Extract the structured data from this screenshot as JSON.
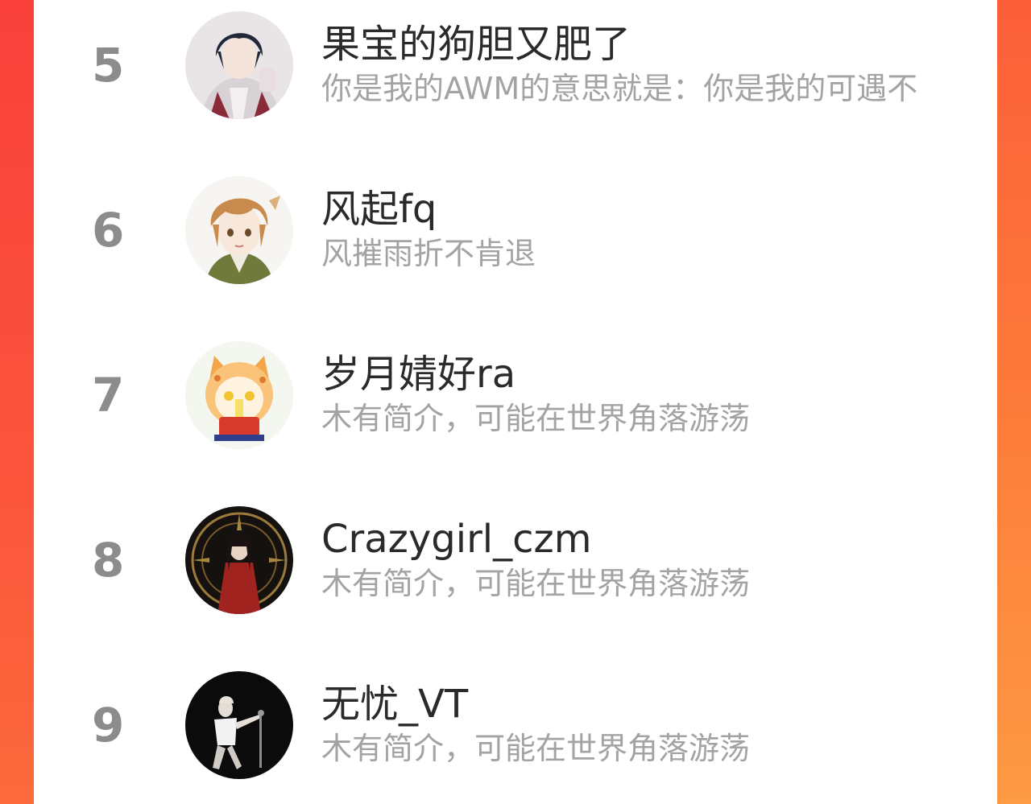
{
  "ranking": {
    "entries": [
      {
        "rank": "5",
        "name": "果宝的狗胆又肥了",
        "bio": "你是我的AWM的意思就是：你是我的可遇不"
      },
      {
        "rank": "6",
        "name": "风起fq",
        "bio": "风摧雨折不肯退"
      },
      {
        "rank": "7",
        "name": "岁月婧好ra",
        "bio": "木有简介，可能在世界角落游荡"
      },
      {
        "rank": "8",
        "name": "Crazygirl_czm",
        "bio": "木有简介，可能在世界角落游荡"
      },
      {
        "rank": "9",
        "name": "无忧_VT",
        "bio": "木有简介，可能在世界角落游荡"
      }
    ]
  },
  "colors": {
    "accent_left": "#f9403b",
    "accent_right": "#fd8a3e",
    "rank_gray": "#8c8c8c",
    "name_text": "#2a2a2a",
    "bio_text": "#a3a3a3"
  },
  "icons": {
    "avatar_5": "anime-boy-avatar",
    "avatar_6": "anime-boy-brown-hair-avatar",
    "avatar_7": "cartoon-cat-hood-avatar",
    "avatar_8": "red-robe-character-avatar",
    "avatar_9": "singer-on-stage-avatar"
  }
}
